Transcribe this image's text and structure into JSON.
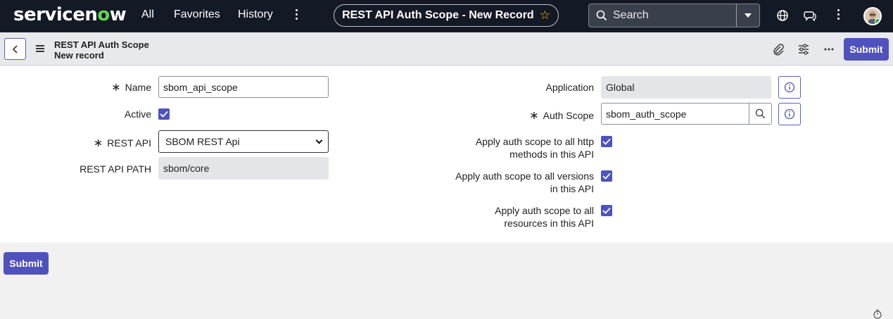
{
  "nav": {
    "brand_prefix": "servicen",
    "brand_o": "o",
    "brand_suffix": "w",
    "links": [
      "All",
      "Favorites",
      "History"
    ],
    "record_title": "REST API Auth Scope - New Record",
    "search_placeholder": "Search",
    "icons": [
      "more-vertical-icon",
      "star-icon",
      "search-icon",
      "globe-icon",
      "chat-icon",
      "more-vertical-icon",
      "avatar"
    ]
  },
  "header": {
    "title_line1": "REST API Auth Scope",
    "title_line2": "New record",
    "submit_label": "Submit"
  },
  "form": {
    "left": {
      "name_label": "Name",
      "name_value": "sbom_api_scope",
      "active_label": "Active",
      "active_checked": true,
      "rest_api_label": "REST API",
      "rest_api_value": "SBOM REST Api",
      "rest_api_path_label": "REST API PATH",
      "rest_api_path_value": "sbom/core"
    },
    "right": {
      "application_label": "Application",
      "application_value": "Global",
      "auth_scope_label": "Auth Scope",
      "auth_scope_value": "sbom_auth_scope",
      "http_methods_line1": "Apply auth scope to all http",
      "http_methods_line2": "methods in this API",
      "versions_line1": "Apply auth scope to all versions",
      "versions_line2": "in this API",
      "resources_line1": "Apply auth scope to all",
      "resources_line2": "resources in this API"
    }
  },
  "footer": {
    "submit_label": "Submit"
  },
  "colors": {
    "nav_bg": "#141926",
    "accent": "#4f52bd",
    "brand_green": "#62d84e",
    "readonly_bg": "#e4e5e8"
  }
}
